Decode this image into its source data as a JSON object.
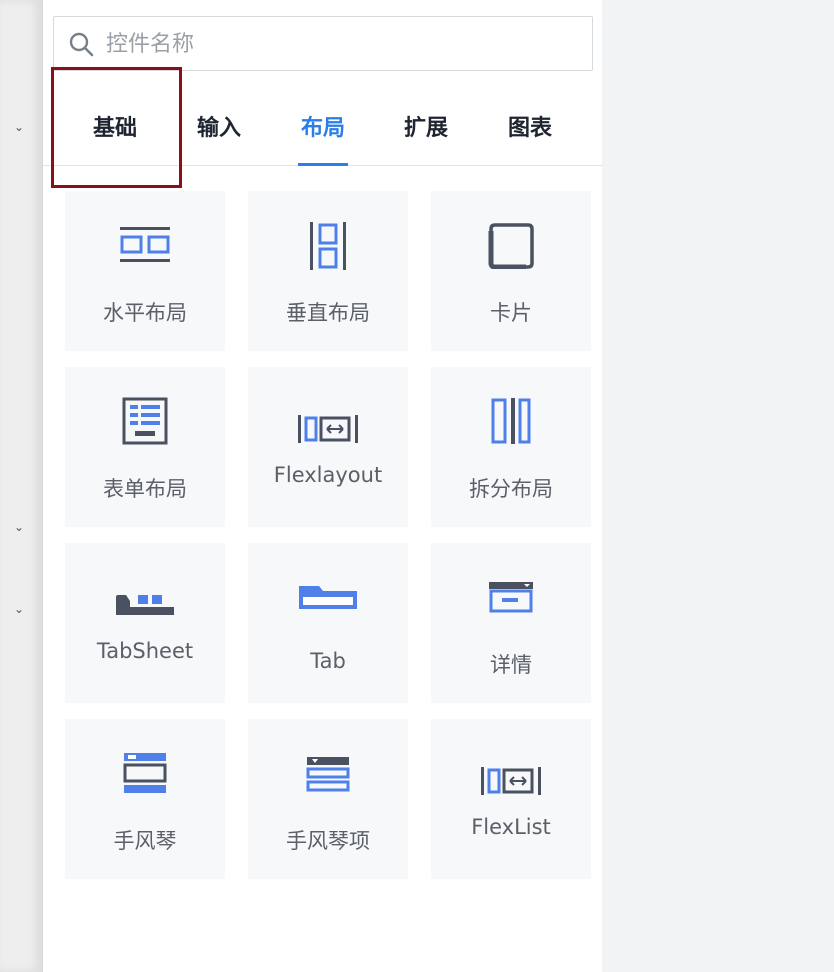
{
  "search": {
    "placeholder": "控件名称",
    "value": ""
  },
  "tabs": [
    {
      "label": "基础",
      "active": false
    },
    {
      "label": "输入",
      "active": false
    },
    {
      "label": "布局",
      "active": true
    },
    {
      "label": "扩展",
      "active": false
    },
    {
      "label": "图表",
      "active": false
    }
  ],
  "components": [
    {
      "label": "水平布局",
      "icon": "horizontal-layout-icon"
    },
    {
      "label": "垂直布局",
      "icon": "vertical-layout-icon"
    },
    {
      "label": "卡片",
      "icon": "card-icon"
    },
    {
      "label": "表单布局",
      "icon": "form-layout-icon"
    },
    {
      "label": "Flexlayout",
      "icon": "flexlayout-icon"
    },
    {
      "label": "拆分布局",
      "icon": "split-layout-icon"
    },
    {
      "label": "TabSheet",
      "icon": "tabsheet-icon"
    },
    {
      "label": "Tab",
      "icon": "tab-icon"
    },
    {
      "label": "详情",
      "icon": "detail-icon"
    },
    {
      "label": "手风琴",
      "icon": "accordion-icon"
    },
    {
      "label": "手风琴项",
      "icon": "accordion-item-icon"
    },
    {
      "label": "FlexList",
      "icon": "flexlist-icon"
    }
  ],
  "colors": {
    "accent": "#2b7de9",
    "icon_blue": "#4f7fe8",
    "icon_dark": "#4a5160",
    "highlight": "#8b0f1a"
  }
}
